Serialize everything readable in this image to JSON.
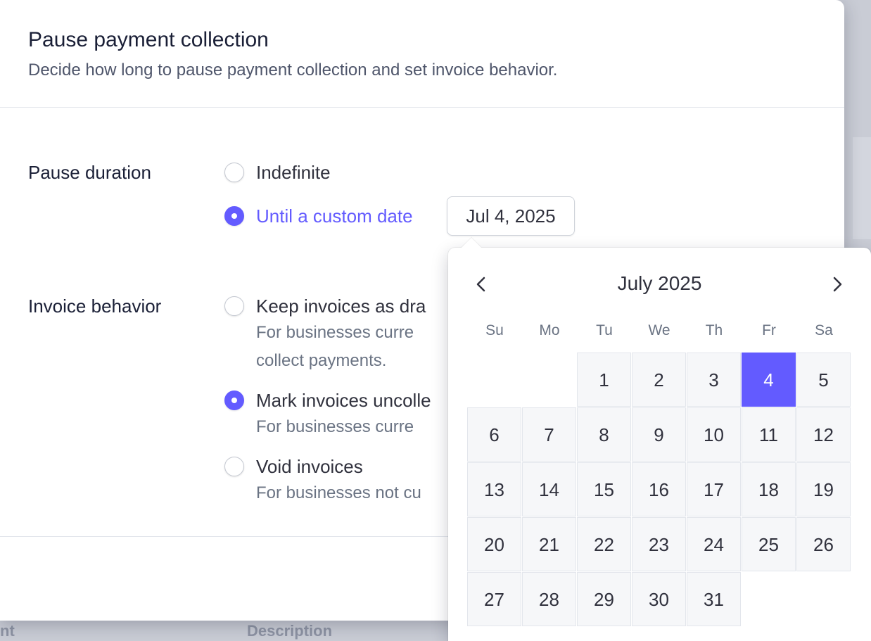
{
  "modal": {
    "title": "Pause payment collection",
    "subtitle": "Decide how long to pause payment collection and set invoice behavior."
  },
  "pause_duration": {
    "label": "Pause duration",
    "options": [
      {
        "label": "Indefinite",
        "checked": false
      },
      {
        "label": "Until a custom date",
        "checked": true
      }
    ],
    "date_value": "Jul 4, 2025"
  },
  "invoice_behavior": {
    "label": "Invoice behavior",
    "options": [
      {
        "label": "Keep invoices as dra",
        "desc_lines": [
          "For businesses curre",
          "collect payments."
        ],
        "checked": false
      },
      {
        "label": "Mark invoices uncolle",
        "desc_lines": [
          "For businesses curre"
        ],
        "checked": true
      },
      {
        "label": "Void invoices",
        "desc_lines": [
          "For businesses not cu"
        ],
        "checked": false
      }
    ]
  },
  "calendar": {
    "month_label": "July 2025",
    "weekdays": [
      "Su",
      "Mo",
      "Tu",
      "We",
      "Th",
      "Fr",
      "Sa"
    ],
    "first_weekday": 2,
    "days_in_month": 31,
    "selected_day": 4,
    "colors": {
      "accent": "#635bff",
      "cell": "#f6f7f9"
    }
  },
  "background": {
    "table_headers": [
      "nt",
      "Description"
    ]
  }
}
